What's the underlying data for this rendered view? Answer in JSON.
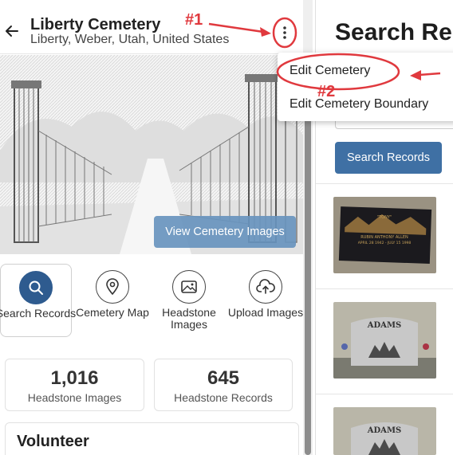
{
  "header": {
    "title": "Liberty Cemetery",
    "subtitle": "Liberty, Weber, Utah, United States"
  },
  "hero": {
    "view_images_label": "View Cemetery Images"
  },
  "actions": [
    {
      "label": "Search Records",
      "icon": "search-icon"
    },
    {
      "label": "Cemetery Map",
      "icon": "map-pin-icon"
    },
    {
      "label": "Headstone Images",
      "icon": "image-icon"
    },
    {
      "label": "Upload Images",
      "icon": "cloud-upload-icon"
    }
  ],
  "stats": [
    {
      "value": "1,016",
      "caption": "Headstone Images"
    },
    {
      "value": "645",
      "caption": "Headstone Records"
    }
  ],
  "volunteer": {
    "title": "Volunteer"
  },
  "right_panel": {
    "title": "Search Rec",
    "search_button": "Search Records"
  },
  "menu": {
    "items": [
      "Edit Cemetery",
      "Edit Cemetery Boundary"
    ]
  },
  "annotations": {
    "label1": "#1",
    "label2": "#2",
    "color": "#e0393e"
  },
  "headstones": [
    {
      "name": "\"TONY\"",
      "line2": "RUBIN ANTHONY ALLEN",
      "line3": "APRIL 28 1942 - JULY 15 1998"
    },
    {
      "name": "ADAMS",
      "line2": "",
      "line3": ""
    },
    {
      "name": "ADAMS",
      "line2": "",
      "line3": ""
    }
  ]
}
